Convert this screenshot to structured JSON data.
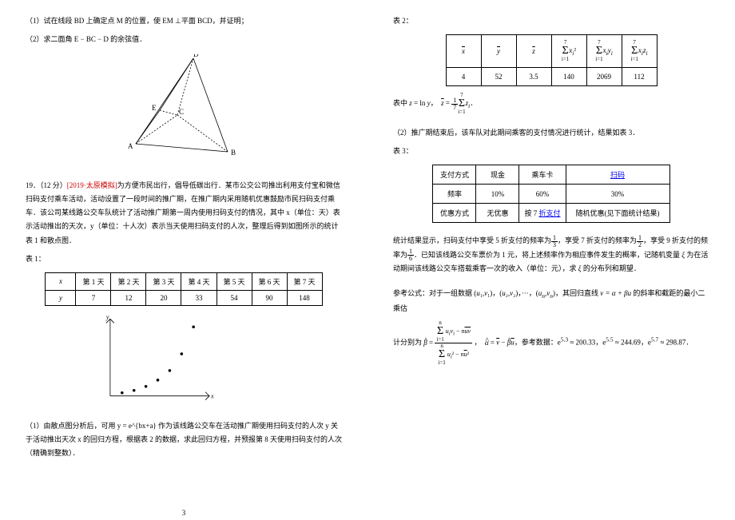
{
  "left": {
    "q1a": "（1）试在线段 BD 上确定点 M 的位置，使 EM ⊥平面 BCD，并证明；",
    "q1b": "（2）求二面角 E − BC − D 的余弦值．",
    "q19": {
      "num": "19．（12 分）",
      "tag": "[2019·太原模拟]",
      "text1": "为方便市民出行，倡导低碳出行．某市公交公司推出利用支付宝和微信扫码支付乘车活动，活动设置了一段时间的推广期，在推广期内采用随机优惠鼓励市民扫码支付乘车．该公司某线路公交车队统计了活动推广期第一周内使用扫码支付的情况，其中 x（单位：天）表示活动推出的天次，y（单位：十人次）表示当天使用扫码支付的人次，整理后得到如图所示的统计表 1 和散点图．",
      "table1Label": "表 1：",
      "table1": {
        "head": [
          "x",
          "第 1 天",
          "第 2 天",
          "第 3 天",
          "第 4 天",
          "第 5 天",
          "第 6 天",
          "第 7 天"
        ],
        "row": [
          "y",
          "7",
          "12",
          "20",
          "33",
          "54",
          "90",
          "148"
        ]
      },
      "q19_1": "（1）由散点图分析后，可用 y = e^{bx+a} 作为该线路公交车在活动推广期使用扫码支付的人次 y 关于活动推出天次 x 的回归方程，根据表 2 的数据，求此回归方程，并预报第 8 天使用扫码支付的人次（精确到整数）．"
    }
  },
  "right": {
    "table2Label": "表 2：",
    "table2": {
      "r1c1": "x̄",
      "r1c2": "ȳ",
      "r1c3": "z̄",
      "r1c4": "Σxᵢ²",
      "r1c5": "Σxᵢyᵢ",
      "r1c6": "Σxᵢzᵢ",
      "r2c1": "4",
      "r2c2": "52",
      "r2c3": "3.5",
      "r2c4": "140",
      "r2c5": "2069",
      "r2c6": "112"
    },
    "zdef": "表中 z = ln y，  z̄ = (1/7) Σ zᵢ．",
    "q19_2": "（2）推广期结束后，该车队对此期间乘客的支付情况进行统计，结果如表 3．",
    "table3Label": "表 3：",
    "table3": {
      "r1": [
        "支付方式",
        "现金",
        "乘车卡",
        "扫码"
      ],
      "r2": [
        "频率",
        "10%",
        "60%",
        "30%"
      ],
      "r3": [
        "优惠方式",
        "无优惠",
        "按 7 折支付",
        "随机优惠(见下面统计结果)"
      ]
    },
    "stats": "统计结果显示，扫码支付中享受 5 折支付的频率为 1/3，享受 7 折支付的频率为 1/2，享受 9 折支付的频率为 1/6．已知该线路公交车票价为 1 元，将上述频率作为相应事件发生的概率，记随机变量 ξ 为在活动期间该线路公交车搭载乘客一次的收入（单位：元），求 ξ 的分布列和期望．",
    "ref1": "参考公式：对于一组数据 (u₁,v₁)，(u₂,v₂)，···，(uₙ,vₙ)，其回归直线 v = α + βu 的斜率和截距的最小二乘估",
    "ref2a": "计分别为 β̂ =",
    "ref2b": "，  α̂ = v̄ − β̂ū，参考数据：e^{5.3} ≈ 200.33，e^{5.5} ≈ 244.69，e^{5.7} ≈ 298.87．",
    "formula": {
      "num": "Σ uᵢvᵢ − n ū v̄",
      "den": "Σ uᵢ² − n ū²",
      "lo": "i=1",
      "hi": "n"
    }
  },
  "pagenum": "3",
  "chart_data": {
    "type": "scatter",
    "title": "",
    "xlabel": "x",
    "ylabel": "y",
    "xlim": [
      0,
      8
    ],
    "ylim": [
      0,
      160
    ],
    "series": [
      {
        "name": "y",
        "x": [
          1,
          2,
          3,
          4,
          5,
          6,
          7
        ],
        "y": [
          7,
          12,
          20,
          33,
          54,
          90,
          148
        ]
      }
    ]
  }
}
